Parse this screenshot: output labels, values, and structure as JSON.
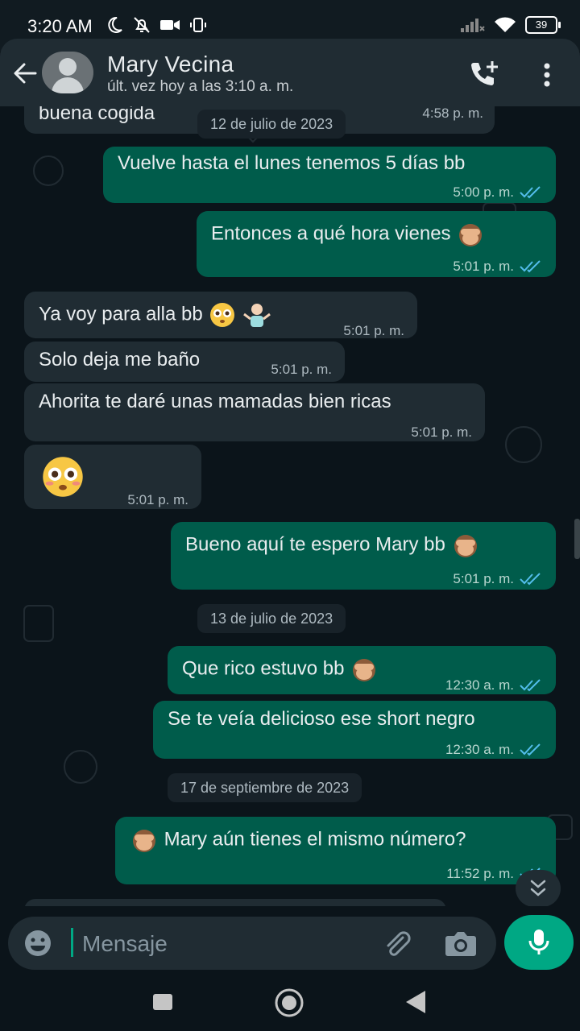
{
  "status_bar": {
    "time": "3:20 AM",
    "battery": "39"
  },
  "header": {
    "contact_name": "Mary Vecina",
    "last_seen": "últ. vez hoy a las 3:10 a. m."
  },
  "messages": [
    {
      "dir": "in",
      "text": "buena cogida",
      "time": "4:58 p. m."
    },
    {
      "dir": "out",
      "text": "Vuelve hasta el lunes tenemos 5 días bb",
      "time": "5:00 p. m."
    },
    {
      "dir": "out",
      "text": "Entonces a qué hora vienes",
      "time": "5:01 p. m."
    },
    {
      "dir": "in",
      "text": "Ya voy para alla bb",
      "time": "5:01 p. m."
    },
    {
      "dir": "in",
      "text": "Solo deja me baño",
      "time": "5:01 p. m."
    },
    {
      "dir": "in",
      "text": "Ahorita te daré unas mamadas bien ricas",
      "time": "5:01 p. m."
    },
    {
      "dir": "in",
      "text": "",
      "time": "5:01 p. m."
    },
    {
      "dir": "out",
      "text": "Bueno aquí te espero Mary bb",
      "time": "5:01 p. m."
    },
    {
      "dir": "out",
      "text": "Que rico estuvo bb",
      "time": "12:30 a. m."
    },
    {
      "dir": "out",
      "text": "Se te veía delicioso ese short negro",
      "time": "12:30 a. m."
    },
    {
      "dir": "out",
      "text": "Mary aún tienes el mismo número?",
      "time": "11:52 p. m."
    }
  ],
  "date_separators": [
    "12 de julio de 2023",
    "13 de julio de 2023",
    "17 de septiembre de 2023"
  ],
  "composer": {
    "placeholder": "Mensaje"
  },
  "colors": {
    "bg": "#0b141a",
    "incoming": "#202c33",
    "outgoing": "#005c4b",
    "accent": "#00a884",
    "read_ticks": "#53bdeb"
  },
  "icons": [
    "back-arrow-icon",
    "avatar-placeholder-icon",
    "add-call-icon",
    "more-vert-icon",
    "emoji-icon",
    "attach-icon",
    "camera-icon",
    "mic-icon",
    "scroll-down-icon"
  ]
}
